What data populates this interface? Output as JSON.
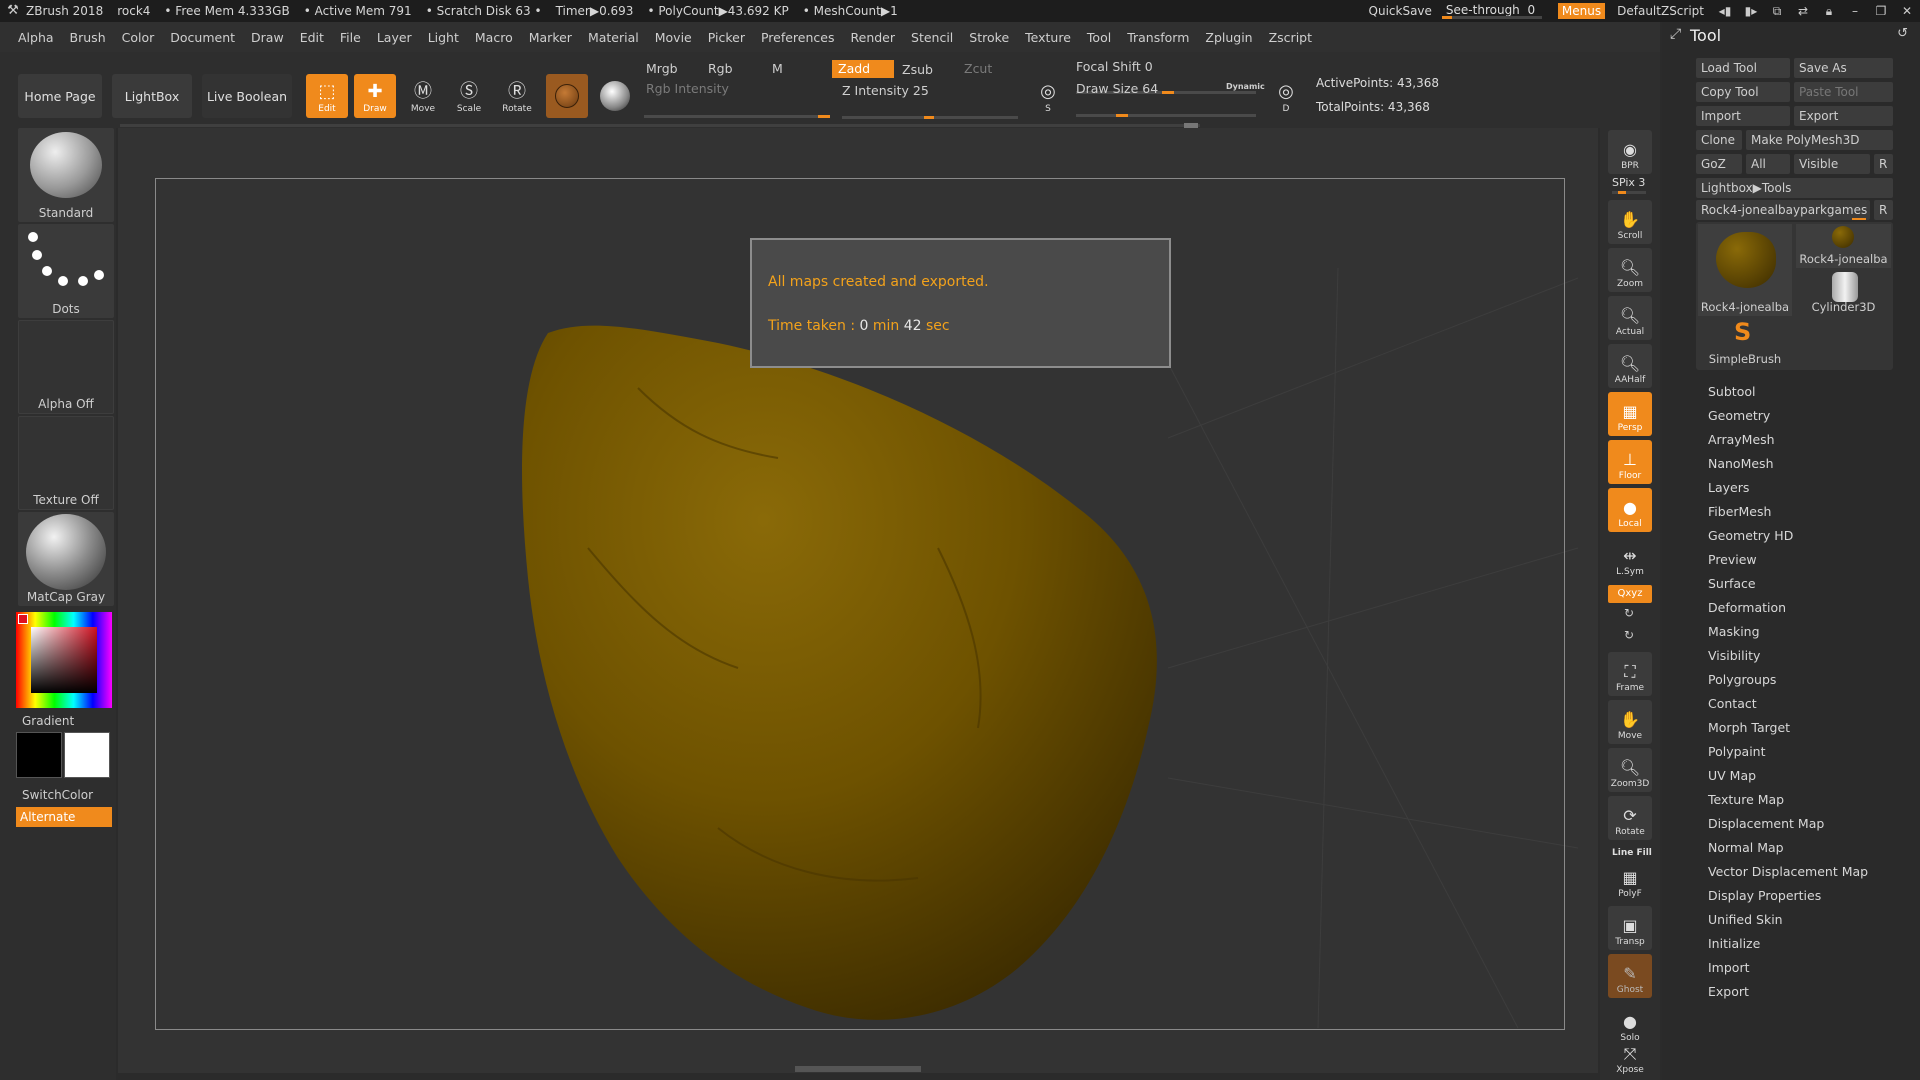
{
  "titlebar": {
    "app": "ZBrush 2018",
    "document": "rock4",
    "free_mem": "• Free Mem 4.333GB",
    "active_mem": "• Active Mem 791",
    "scratch": "• Scratch Disk 63 •",
    "timer": "Timer▶0.693",
    "polycount": "• PolyCount▶43.692 KP",
    "meshcount": "• MeshCount▶1",
    "quicksave": "QuickSave",
    "seethrough_label": "See-through",
    "seethrough_value": "0",
    "seethrough_level": 0,
    "menus": "Menus",
    "script": "DefaultZScript"
  },
  "menubar": [
    "Alpha",
    "Brush",
    "Color",
    "Document",
    "Draw",
    "Edit",
    "File",
    "Layer",
    "Light",
    "Macro",
    "Marker",
    "Material",
    "Movie",
    "Picker",
    "Preferences",
    "Render",
    "Stencil",
    "Stroke",
    "Texture",
    "Tool",
    "Transform",
    "Zplugin",
    "Zscript"
  ],
  "shelf": {
    "home": "Home Page",
    "lightbox": "LightBox",
    "live_boolean": "Live Boolean",
    "edit": "Edit",
    "draw": "Draw",
    "move": "Move",
    "scale": "Scale",
    "rotate": "Rotate",
    "mrgb": "Mrgb",
    "rgb": "Rgb",
    "m": "M",
    "zadd": "Zadd",
    "zsub": "Zsub",
    "zcut": "Zcut",
    "rgb_intensity": "Rgb Intensity",
    "z_intensity": "Z Intensity 25",
    "focal_shift": "Focal Shift 0",
    "draw_size": "Draw Size 64",
    "dynamic": "Dynamic",
    "active_points": "ActivePoints: 43,368",
    "total_points": "TotalPoints: 43,368"
  },
  "left": {
    "brush": "Standard",
    "stroke": "Dots",
    "alpha": "Alpha Off",
    "texture": "Texture Off",
    "material": "MatCap Gray",
    "gradient": "Gradient",
    "switchcolor": "SwitchColor",
    "alternate": "Alternate"
  },
  "notice": {
    "line1": "All maps created and exported.",
    "time_prefix": "Time taken : ",
    "min_value": "0",
    "min_label": " min ",
    "sec_value": "42",
    "sec_label": " sec"
  },
  "rightcol": {
    "bpr": "BPR",
    "spix": "SPix 3",
    "scroll": "Scroll",
    "zoom": "Zoom",
    "actual": "Actual",
    "aahalf": "AAHalf",
    "persp": "Persp",
    "floor": "Floor",
    "local": "Local",
    "lsym": "L.Sym",
    "xyz": "Qxyz",
    "frame": "Frame",
    "move": "Move",
    "zoom3d": "Zoom3D",
    "rotate": "Rotate",
    "linefill": "Line Fill",
    "polyf": "PolyF",
    "transp": "Transp",
    "ghost": "Ghost",
    "solo": "Solo",
    "xpose": "Xpose"
  },
  "tool": {
    "title": "Tool",
    "load_tool": "Load Tool",
    "save_as": "Save As",
    "copy_tool": "Copy Tool",
    "paste_tool": "Paste Tool",
    "import": "Import",
    "export": "Export",
    "clone": "Clone",
    "make_polymesh": "Make PolyMesh3D",
    "goz": "GoZ",
    "all": "All",
    "visible": "Visible",
    "r": "R",
    "lightbox_tools": "Lightbox▶Tools",
    "current_tool": "Rock4-jonealbayparkgames",
    "thumb1": "Rock4-jonealba",
    "thumb2": "Rock4-jonealba",
    "thumb3": "Cylinder3D",
    "thumb4": "SimpleBrush",
    "sections": [
      "Subtool",
      "Geometry",
      "ArrayMesh",
      "NanoMesh",
      "Layers",
      "FiberMesh",
      "Geometry HD",
      "Preview",
      "Surface",
      "Deformation",
      "Masking",
      "Visibility",
      "Polygroups",
      "Contact",
      "Morph Target",
      "Polypaint",
      "UV Map",
      "Texture Map",
      "Displacement Map",
      "Normal Map",
      "Vector Displacement Map",
      "Display Properties",
      "Unified Skin",
      "Initialize",
      "Import",
      "Export"
    ]
  },
  "colors": {
    "accent": "#f08a1c",
    "notice_text": "#f3a21b",
    "rock": "#6e5200"
  }
}
